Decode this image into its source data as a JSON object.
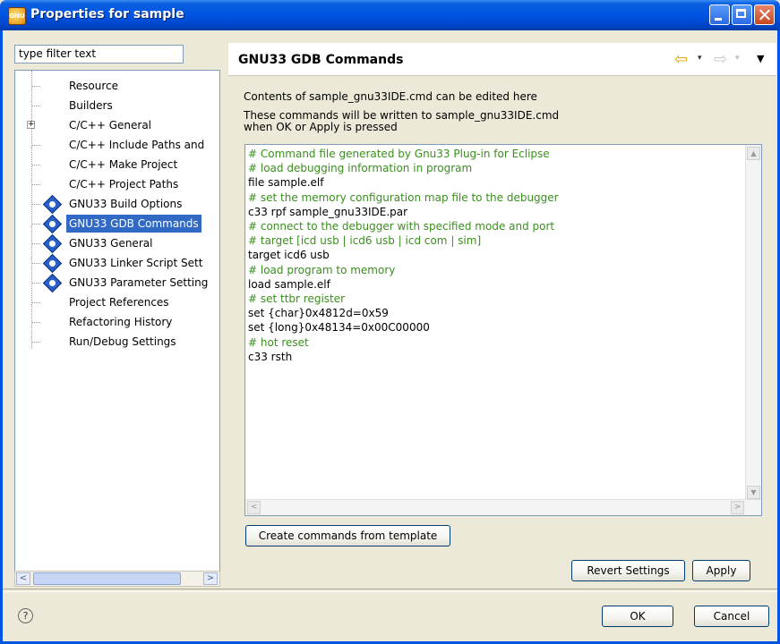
{
  "window": {
    "title": "Properties for sample",
    "app_icon_label": "GNU"
  },
  "sidebar": {
    "filter_placeholder": "type filter text",
    "items": [
      {
        "label": "Resource",
        "icon": "none"
      },
      {
        "label": "Builders",
        "icon": "none"
      },
      {
        "label": "C/C++ General",
        "icon": "expander-plus"
      },
      {
        "label": "C/C++ Include Paths and",
        "icon": "none"
      },
      {
        "label": "C/C++ Make Project",
        "icon": "none"
      },
      {
        "label": "C/C++ Project Paths",
        "icon": "none"
      },
      {
        "label": "GNU33 Build Options",
        "icon": "gnu-icon"
      },
      {
        "label": "GNU33 GDB Commands",
        "icon": "gnu-icon"
      },
      {
        "label": "GNU33 General",
        "icon": "gnu-icon"
      },
      {
        "label": "GNU33 Linker Script Sett",
        "icon": "gnu-icon"
      },
      {
        "label": "GNU33 Parameter Setting",
        "icon": "gnu-icon"
      },
      {
        "label": "Project References",
        "icon": "none"
      },
      {
        "label": "Refactoring History",
        "icon": "none"
      },
      {
        "label": "Run/Debug Settings",
        "icon": "none"
      }
    ],
    "selected": "GNU33 GDB Commands"
  },
  "page": {
    "title": "GNU33 GDB Commands",
    "desc1": "Contents of sample_gnu33IDE.cmd can be edited here",
    "desc2a": "These commands will be written to  sample_gnu33IDE.cmd",
    "desc2b": "when OK or Apply is pressed",
    "editor_lines": [
      {
        "text": "# Command file generated by Gnu33 Plug-in for Eclipse",
        "kind": "comment"
      },
      {
        "text": "# load debugging information in program",
        "kind": "comment"
      },
      {
        "text": "file sample.elf",
        "kind": "cmd"
      },
      {
        "text": "# set the memory configuration map file to the debugger",
        "kind": "comment"
      },
      {
        "text": "c33 rpf sample_gnu33IDE.par",
        "kind": "cmd"
      },
      {
        "text": "# connect to the debugger with specified mode and port",
        "kind": "comment"
      },
      {
        "text": "# target [icd usb | icd6 usb | icd com | sim]",
        "kind": "comment"
      },
      {
        "text": "target icd6 usb",
        "kind": "cmd"
      },
      {
        "text": "# load program to memory",
        "kind": "comment"
      },
      {
        "text": "load sample.elf",
        "kind": "cmd"
      },
      {
        "text": "# set ttbr register",
        "kind": "comment"
      },
      {
        "text": "set {char}0x4812d=0x59",
        "kind": "cmd"
      },
      {
        "text": "set {long}0x48134=0x00C00000",
        "kind": "cmd"
      },
      {
        "text": "# hot reset",
        "kind": "comment"
      },
      {
        "text": "c33 rsth",
        "kind": "cmd"
      }
    ],
    "comment_color": "#3a8f1e"
  },
  "buttons": {
    "template": "Create commands from template",
    "revert": "Revert Settings",
    "apply": "Apply",
    "ok": "OK",
    "cancel": "Cancel"
  },
  "glyphs": {
    "help": "?",
    "expander": "+",
    "scroll_left": "<",
    "scroll_right": ">",
    "nav_back": "⇦",
    "nav_forward": "⇨",
    "dropdown": "▾",
    "view_menu": "▼"
  }
}
